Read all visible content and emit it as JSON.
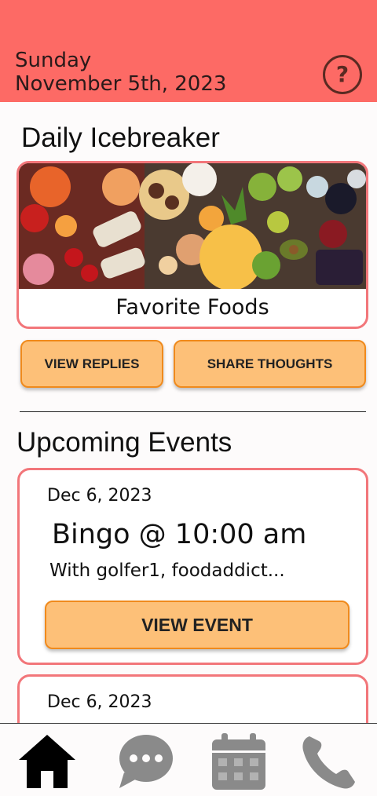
{
  "header": {
    "day": "Sunday",
    "date": "November 5th, 2023",
    "help_symbol": "?",
    "help_icon": "question-circle-icon",
    "color": "#fd6a65"
  },
  "icebreaker": {
    "section_title": "Daily Icebreaker",
    "topic": "Favorite Foods",
    "image_icon": "food-photo",
    "view_replies_label": "VIEW REPLIES",
    "share_label": "SHARE THOUGHTS"
  },
  "events": {
    "section_title": "Upcoming Events",
    "items": [
      {
        "date": "Dec 6, 2023",
        "title": "Bingo @ 10:00 am",
        "with": "With golfer1, foodaddict...",
        "button_label": "VIEW EVENT"
      },
      {
        "date": "Dec 6, 2023"
      }
    ]
  },
  "nav": {
    "items": [
      {
        "icon": "home-icon",
        "active": true
      },
      {
        "icon": "chat-icon",
        "active": false
      },
      {
        "icon": "calendar-icon",
        "active": false
      },
      {
        "icon": "phone-icon",
        "active": false
      }
    ]
  },
  "colors": {
    "accent": "#fd6a65",
    "card_border": "#f2767a",
    "button_fill": "#fdc078",
    "button_border": "#f08a1c",
    "nav_inactive": "#8a8a8a"
  }
}
